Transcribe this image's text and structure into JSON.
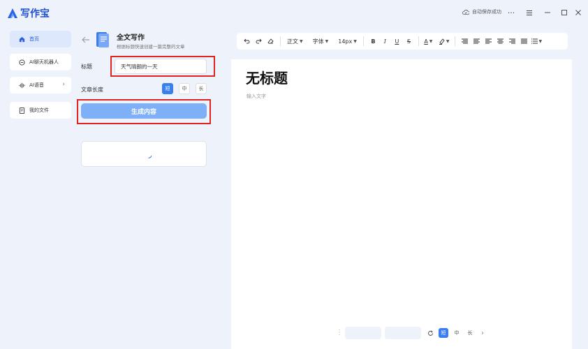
{
  "app": {
    "name": "写作宝"
  },
  "titlebar": {
    "save_status": "自动保存成功",
    "menu_icon": "more-horizontal-icon"
  },
  "nav": {
    "items": [
      {
        "label": "首页",
        "icon": "home-icon",
        "active": true
      },
      {
        "label": "AI聊天机器人",
        "icon": "chat-icon",
        "active": false
      },
      {
        "label": "AI语音",
        "icon": "waveform-icon",
        "active": false
      },
      {
        "label": "我的文件",
        "icon": "file-icon",
        "active": false
      }
    ]
  },
  "panel": {
    "title": "全文写作",
    "subtitle": "根据标题快速创建一篇完整的文章",
    "title_label": "标题",
    "title_value": "天气晴朗的一天",
    "length_label": "文章长度",
    "length_options": [
      "短",
      "中",
      "长"
    ],
    "length_selected": "短",
    "generate_label": "生成内容"
  },
  "toolbar": {
    "paragraph": "正文",
    "font": "字体",
    "size": "14px",
    "bold": "B",
    "italic": "I",
    "underline": "U",
    "strike": "S",
    "font_color": "A"
  },
  "editor": {
    "doc_title": "无标题",
    "placeholder": "输入文字"
  },
  "bottom_bar": {
    "lengths": [
      "短",
      "中",
      "长"
    ],
    "selected": "短"
  },
  "colors": {
    "accent": "#3a7ff0",
    "highlight_box": "#e02424",
    "brand": "#1f4fd6"
  }
}
